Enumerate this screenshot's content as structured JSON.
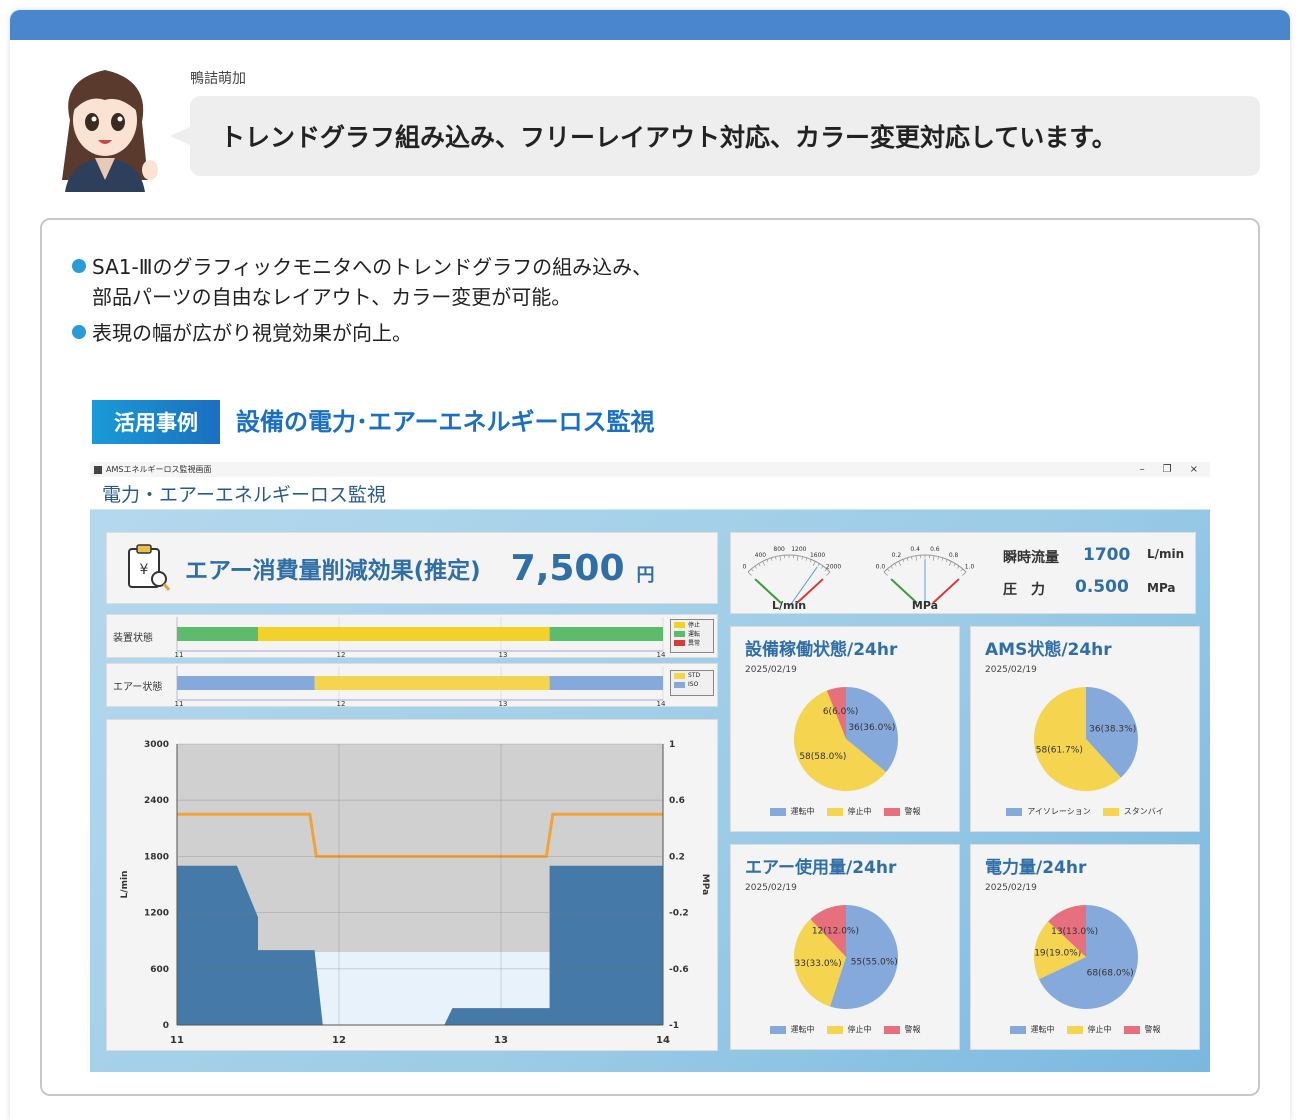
{
  "speaker": {
    "name": "鴨詰萌加"
  },
  "bubble": {
    "text": "トレンドグラフ組み込み、フリーレイアウト対応、カラー変更対応しています。"
  },
  "bullets": [
    "SA1-Ⅲのグラフィックモニタへのトレンドグラフの組み込み、",
    "部品パーツの自由なレイアウト、カラー変更が可能。",
    "表現の幅が広がり視覚効果が向上。"
  ],
  "example": {
    "tag": "活用事例",
    "title": "設備の電力･エアーエネルギーロス監視"
  },
  "app": {
    "window_title": "AMSエネルギーロス監視画面",
    "window_controls": [
      "–",
      "❐",
      "×"
    ],
    "header": "電力・エアーエネルギーロス監視",
    "savings": {
      "label": "エアー消費量削減効果(推定)",
      "value": "7,500",
      "unit": "円",
      "icon_symbol": "¥"
    },
    "flow": {
      "label": "瞬時流量",
      "value": "1700",
      "unit": "L/min",
      "gauge_unit": "L/min",
      "gauge_ticks": [
        "0",
        "400",
        "800",
        "1200",
        "1600",
        "2000"
      ],
      "reading_fraction": 0.85
    },
    "pressure": {
      "label": "圧　力",
      "value": "0.500",
      "unit": "MPa",
      "gauge_unit": "MPa",
      "gauge_ticks": [
        "0.0",
        "0.2",
        "0.4",
        "0.6",
        "0.8",
        "1.0"
      ],
      "reading_fraction": 0.5
    },
    "timeline_axis": [
      "11",
      "12",
      "13",
      "14"
    ],
    "equipment_timeline": {
      "label": "装置状態",
      "legend": [
        {
          "name": "停止",
          "color": "#f2d12a"
        },
        {
          "name": "運転",
          "color": "#5cbc6c"
        },
        {
          "name": "異常",
          "color": "#d63a3a"
        }
      ],
      "segments": [
        {
          "from": 11,
          "to": 11.5,
          "state": "運転"
        },
        {
          "from": 11.5,
          "to": 13.3,
          "state": "停止"
        },
        {
          "from": 13.3,
          "to": 14,
          "state": "運転"
        }
      ]
    },
    "air_timeline": {
      "label": "エアー状態",
      "legend": [
        {
          "name": "STD",
          "color": "#f5d44f"
        },
        {
          "name": "ISO",
          "color": "#86a9dc"
        }
      ],
      "segments": [
        {
          "from": 11,
          "to": 11.85,
          "state": "ISO"
        },
        {
          "from": 11.85,
          "to": 13.3,
          "state": "STD"
        },
        {
          "from": 13.3,
          "to": 14,
          "state": "ISO"
        }
      ]
    },
    "pies": [
      {
        "title": "設備稼働状態/24hr",
        "date": "2025/02/19",
        "slices": [
          {
            "name": "運転中",
            "value": 36,
            "label": "36(36.0%)",
            "color": "#86a9dc"
          },
          {
            "name": "停止中",
            "value": 58,
            "label": "58(58.0%)",
            "color": "#f5d44f"
          },
          {
            "name": "警報",
            "value": 6,
            "label": "6(6.0%)",
            "color": "#e7707f"
          }
        ]
      },
      {
        "title": "AMS状態/24hr",
        "date": "2025/02/19",
        "slices": [
          {
            "name": "アイソレーション",
            "value": 36,
            "label": "36(38.3%)",
            "color": "#86a9dc"
          },
          {
            "name": "スタンバイ",
            "value": 58,
            "label": "58(61.7%)",
            "color": "#f5d44f"
          }
        ]
      },
      {
        "title": "エアー使用量/24hr",
        "date": "2025/02/19",
        "slices": [
          {
            "name": "運転中",
            "value": 55,
            "label": "55(55.0%)",
            "color": "#86a9dc"
          },
          {
            "name": "停止中",
            "value": 33,
            "label": "33(33.0%)",
            "color": "#f5d44f"
          },
          {
            "name": "警報",
            "value": 12,
            "label": "12(12.0%)",
            "color": "#e7707f"
          }
        ]
      },
      {
        "title": "電力量/24hr",
        "date": "2025/02/19",
        "slices": [
          {
            "name": "運転中",
            "value": 68,
            "label": "68(68.0%)",
            "color": "#86a9dc"
          },
          {
            "name": "停止中",
            "value": 19,
            "label": "19(19.0%)",
            "color": "#f5d44f"
          },
          {
            "name": "警報",
            "value": 13,
            "label": "13(13.0%)",
            "color": "#e7707f"
          }
        ]
      }
    ]
  },
  "chart_data": [
    {
      "type": "area",
      "xlabel": "",
      "ylabel": "L/min",
      "ylabel_right": "MPa",
      "x_ticks": [
        "11",
        "12",
        "13",
        "14"
      ],
      "y_ticks": [
        "0",
        "600",
        "1200",
        "1800",
        "2400",
        "3000"
      ],
      "y2_ticks": [
        "-1",
        "-0.6",
        "-0.2",
        "0.2",
        "0.6",
        "1"
      ],
      "xlim": [
        11,
        14
      ],
      "ylim": [
        0,
        3000
      ],
      "y2lim": [
        -1,
        1
      ],
      "grid": true,
      "series": [
        {
          "axis": "left",
          "style": "area",
          "color": "#d0d0d0",
          "x": [
            11,
            11.85,
            11.85,
            13.3,
            13.3,
            14
          ],
          "y": [
            3000,
            3000,
            3000,
            3000,
            3000,
            3000
          ]
        },
        {
          "axis": "left",
          "style": "area",
          "color": "#e8f2fb",
          "x": [
            11,
            11.85,
            11.85,
            13.3,
            13.3,
            14
          ],
          "y": [
            0,
            0,
            780,
            780,
            0,
            0
          ]
        },
        {
          "axis": "left",
          "style": "area",
          "color": "#4479a8",
          "x": [
            11,
            11.37,
            11.5,
            11.5,
            11.85,
            11.85,
            11.9,
            12.65,
            12.7,
            13.1,
            13.3,
            13.3,
            14
          ],
          "y": [
            1700,
            1700,
            1150,
            800,
            800,
            780,
            0,
            0,
            180,
            180,
            180,
            1700,
            1700
          ]
        },
        {
          "axis": "right",
          "style": "line",
          "color": "#f2a23b",
          "x": [
            11,
            11.82,
            11.86,
            13.28,
            13.32,
            14
          ],
          "y": [
            0.5,
            0.5,
            0.2,
            0.2,
            0.5,
            0.5
          ]
        }
      ]
    }
  ]
}
